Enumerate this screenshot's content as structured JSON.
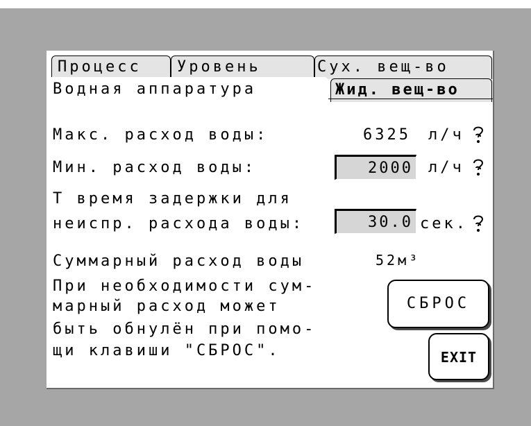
{
  "tabs": [
    {
      "label": "Процесс"
    },
    {
      "label": "Уровень"
    },
    {
      "label": "Сух. вещ-во"
    },
    {
      "label": "Водная аппаратура"
    },
    {
      "label": "Жид. вещ-во"
    }
  ],
  "rows": {
    "max_flow": {
      "label": "Макс. расход воды:",
      "value": "6325",
      "unit": "л/ч"
    },
    "min_flow": {
      "label": "Мин. расход воды:",
      "value": "2000",
      "unit": "л/ч"
    },
    "delay": {
      "label_line1": "Т время задержки для",
      "label_line2": "неиспр. расхода воды:",
      "value": "30.0",
      "unit": "сек."
    },
    "total": {
      "label": "Суммарный расход воды",
      "value": "52м³"
    }
  },
  "info_lines": [
    "При необходимости сум-",
    "марный расход может",
    "быть обнулён при помо-",
    "щи клавиши \"СБРОС\"."
  ],
  "buttons": {
    "reset": "СБРОС",
    "exit": "EXIT"
  },
  "colors": {
    "background": "#a6a6a6",
    "panel": "#ffffff",
    "field": "#d6d6d6",
    "tab": "#e4e4e4"
  }
}
